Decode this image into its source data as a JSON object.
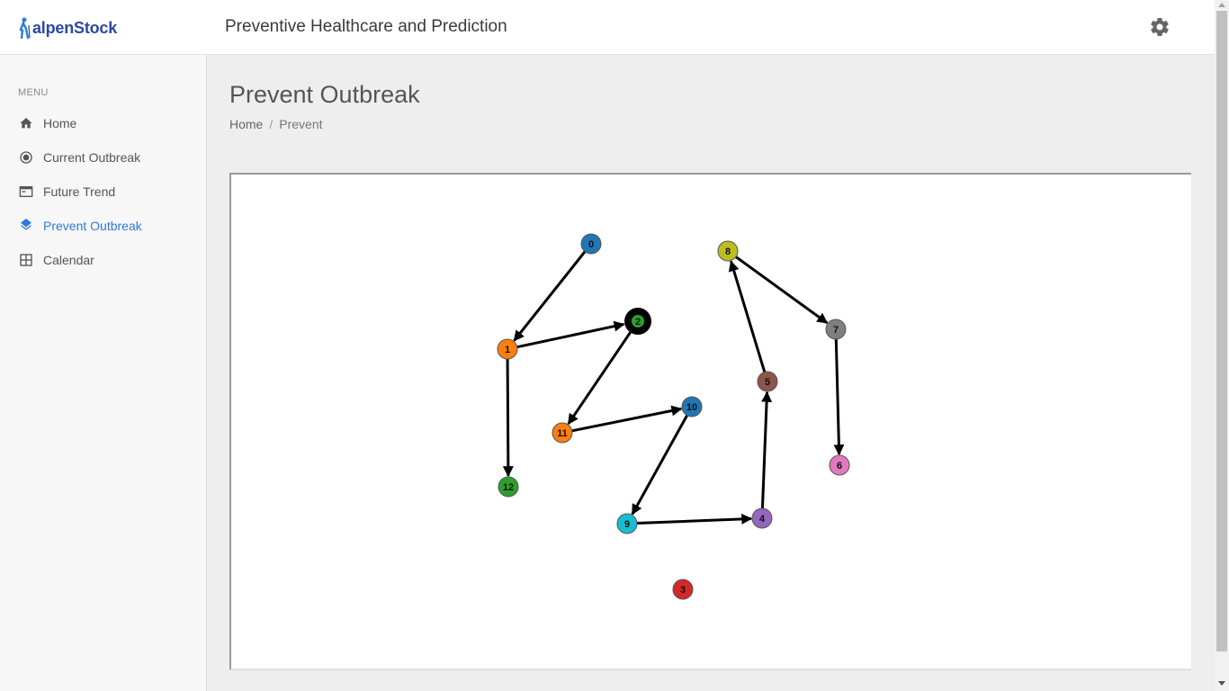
{
  "header": {
    "logo_text": "alpenStock",
    "app_title": "Preventive Healthcare and Prediction",
    "settings_icon": "gear-icon"
  },
  "sidebar": {
    "menu_heading": "MENU",
    "items": [
      {
        "label": "Home",
        "icon": "home-icon",
        "active": false
      },
      {
        "label": "Current Outbreak",
        "icon": "radio-target-icon",
        "active": false
      },
      {
        "label": "Future Trend",
        "icon": "window-icon",
        "active": false
      },
      {
        "label": "Prevent Outbreak",
        "icon": "layers-icon",
        "active": true
      },
      {
        "label": "Calendar",
        "icon": "grid-icon",
        "active": false
      }
    ]
  },
  "main": {
    "title": "Prevent Outbreak",
    "breadcrumb": [
      "Home",
      "Prevent"
    ]
  },
  "graph": {
    "nodes": [
      {
        "id": "0",
        "color": "#1f77b4"
      },
      {
        "id": "1",
        "color": "#ff7f0e"
      },
      {
        "id": "2",
        "color": "#2ca02c",
        "highlight": true
      },
      {
        "id": "3",
        "color": "#d62728"
      },
      {
        "id": "4",
        "color": "#9467bd"
      },
      {
        "id": "5",
        "color": "#8c564b"
      },
      {
        "id": "6",
        "color": "#e377c2"
      },
      {
        "id": "7",
        "color": "#7f7f7f"
      },
      {
        "id": "8",
        "color": "#bcbd22"
      },
      {
        "id": "9",
        "color": "#17becf"
      },
      {
        "id": "10",
        "color": "#1f77b4"
      },
      {
        "id": "11",
        "color": "#ff7f0e"
      },
      {
        "id": "12",
        "color": "#2ca02c"
      }
    ],
    "edges": [
      {
        "from": "0",
        "to": "1"
      },
      {
        "from": "1",
        "to": "2"
      },
      {
        "from": "1",
        "to": "12"
      },
      {
        "from": "2",
        "to": "11"
      },
      {
        "from": "11",
        "to": "10"
      },
      {
        "from": "10",
        "to": "9"
      },
      {
        "from": "9",
        "to": "4"
      },
      {
        "from": "4",
        "to": "5"
      },
      {
        "from": "5",
        "to": "8"
      },
      {
        "from": "8",
        "to": "7"
      },
      {
        "from": "7",
        "to": "6"
      }
    ]
  },
  "colors": {
    "accent": "#2f7ad9",
    "header_bg": "#ffffff",
    "sidebar_bg": "#f7f7f7",
    "page_bg": "#eeeeee"
  }
}
